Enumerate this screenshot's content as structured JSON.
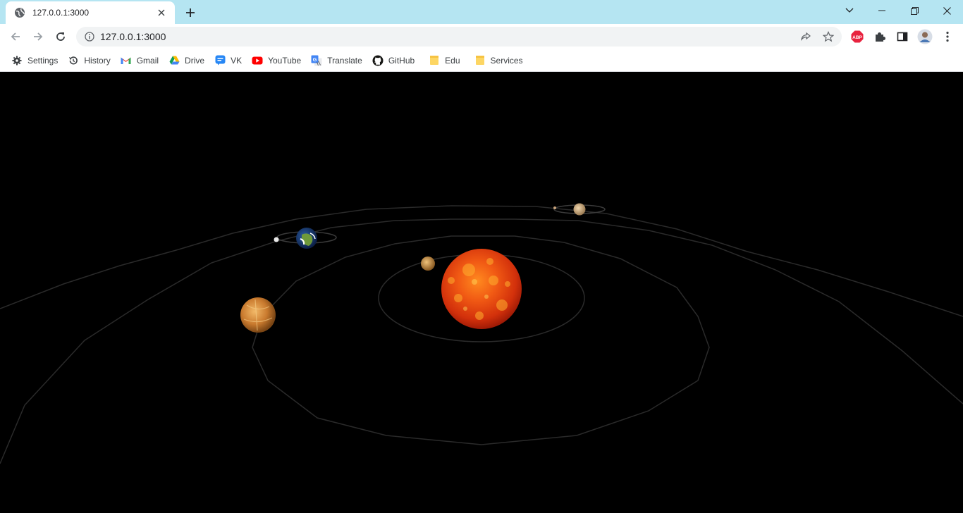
{
  "browser": {
    "tab": {
      "title": "127.0.0.1:3000"
    },
    "address": {
      "url": "127.0.0.1:3000"
    },
    "extensions": {
      "abp_label": "ABP"
    }
  },
  "bookmarks": [
    {
      "label": "Settings",
      "icon": "gear-icon"
    },
    {
      "label": "History",
      "icon": "history-icon"
    },
    {
      "label": "Gmail",
      "icon": "gmail-icon"
    },
    {
      "label": "Drive",
      "icon": "drive-icon"
    },
    {
      "label": "VK",
      "icon": "vk-icon"
    },
    {
      "label": "YouTube",
      "icon": "youtube-icon"
    },
    {
      "label": "Translate",
      "icon": "translate-icon"
    },
    {
      "label": "GitHub",
      "icon": "github-icon"
    },
    {
      "label": "Edu",
      "icon": "folder-icon"
    },
    {
      "label": "Services",
      "icon": "folder-icon"
    }
  ],
  "colors": {
    "tabstrip": "#b5e5f2",
    "scene_background": "#000000",
    "orbit_line": "#2a2a2a",
    "sun": "#e8420c"
  },
  "scene": {
    "bodies": [
      "sun",
      "mercury",
      "venus",
      "earth",
      "moon",
      "mars",
      "mars-moon"
    ]
  }
}
